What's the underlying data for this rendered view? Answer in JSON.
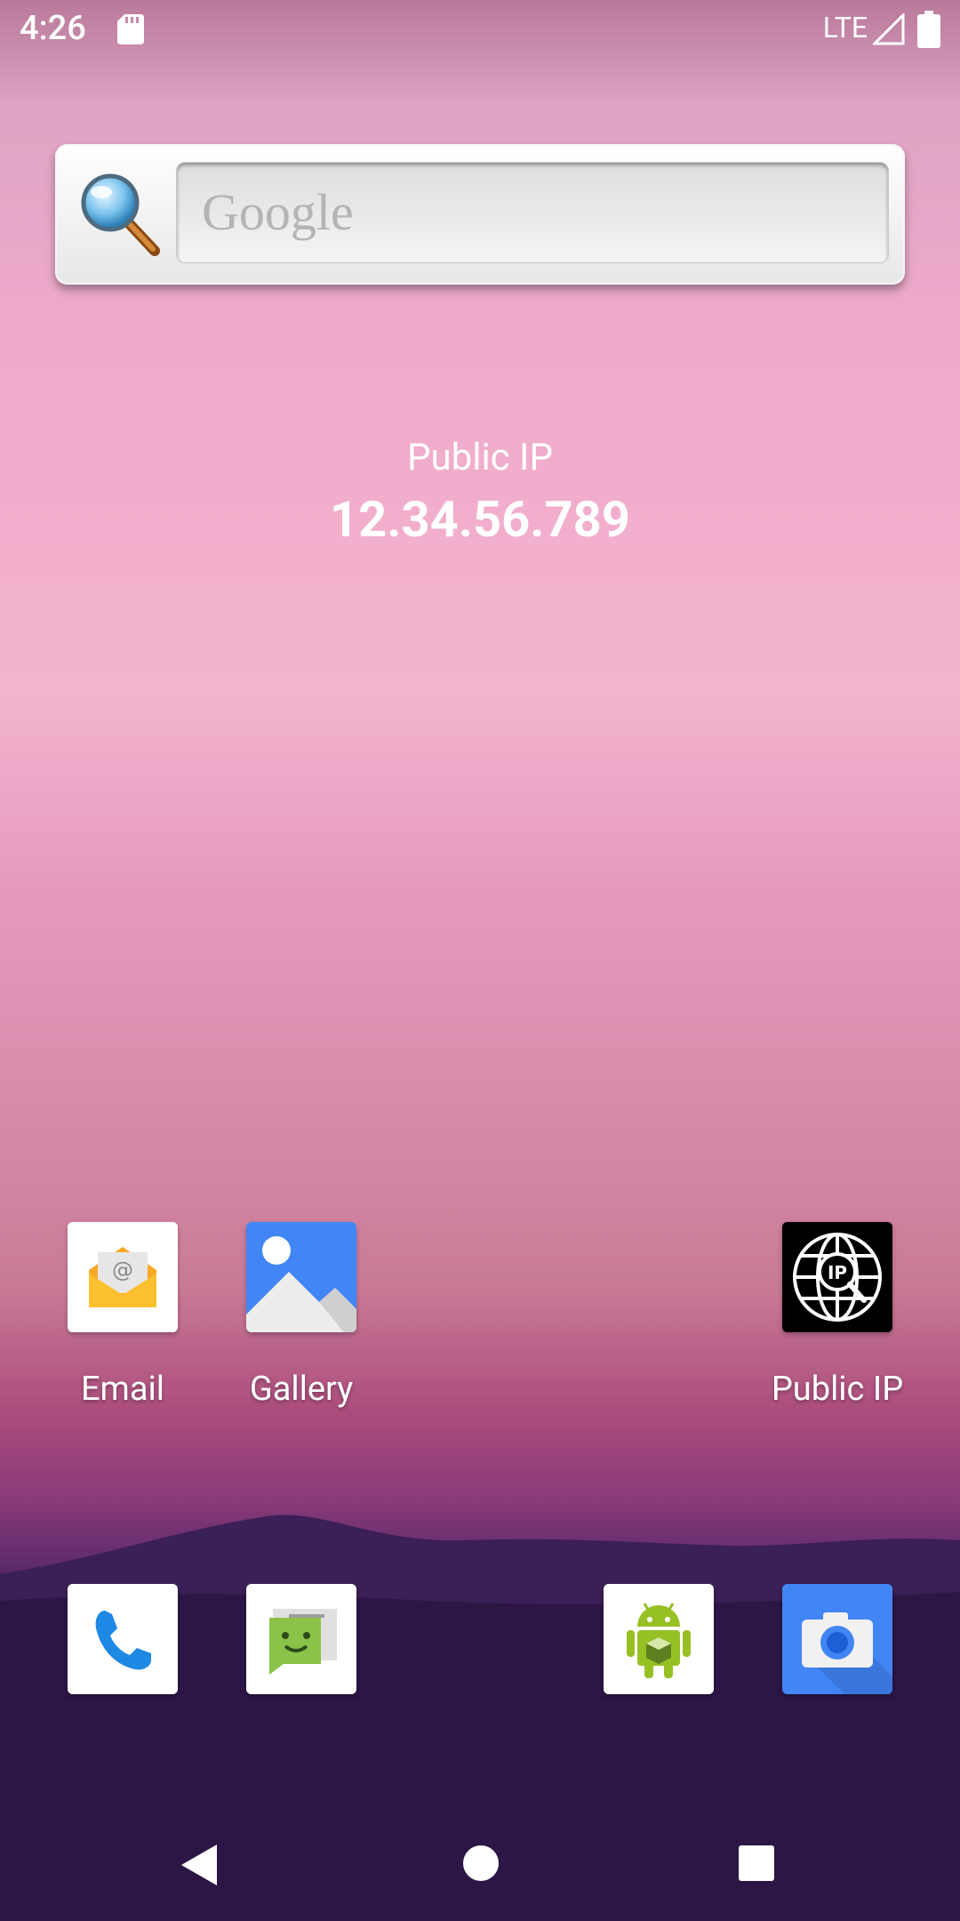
{
  "status_bar": {
    "time": "4:26",
    "network": "LTE",
    "icons": [
      "sd-card-icon",
      "signal-icon",
      "battery-icon"
    ]
  },
  "search_widget": {
    "placeholder": "Google",
    "icon": "magnifier-icon"
  },
  "ip_widget": {
    "title": "Public IP",
    "address": "12.34.56.789"
  },
  "home_apps": [
    {
      "label": "Email",
      "icon": "email-icon"
    },
    {
      "label": "Gallery",
      "icon": "gallery-icon"
    },
    {
      "label": "Public IP",
      "icon": "globe-ip-icon"
    }
  ],
  "dock_apps": [
    {
      "icon": "phone-icon"
    },
    {
      "icon": "messaging-icon"
    },
    {
      "icon": "android-app-icon"
    },
    {
      "icon": "camera-icon"
    }
  ],
  "nav": {
    "buttons": [
      "back-icon",
      "home-icon",
      "recents-icon"
    ]
  },
  "colors": {
    "camera_blue": "#4285f4",
    "gallery_blue": "#4285f4",
    "phone_blue": "#1e88e5",
    "message_green": "#8bc34a",
    "android_green": "#97c024"
  }
}
